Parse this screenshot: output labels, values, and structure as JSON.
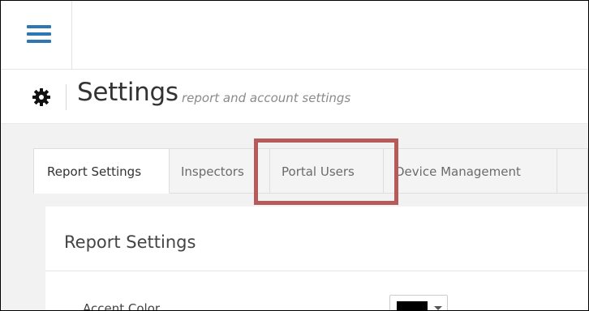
{
  "topbar": {
    "menu_icon": "hamburger-menu-icon",
    "accent_color": "#2f76b4"
  },
  "header": {
    "icon": "gear-icon",
    "title": "Settings",
    "subtitle": "report and account settings"
  },
  "tabs": [
    {
      "label": "Report Settings",
      "active": true
    },
    {
      "label": "Inspectors",
      "active": false
    },
    {
      "label": "Portal Users",
      "active": false
    },
    {
      "label": "Device Management",
      "active": false
    }
  ],
  "panel": {
    "title": "Report Settings",
    "fields": [
      {
        "label": "Accent Color",
        "value": "#000000"
      }
    ]
  },
  "annotation": {
    "highlight_color": "#b75a5a",
    "target": "Portal Users"
  }
}
